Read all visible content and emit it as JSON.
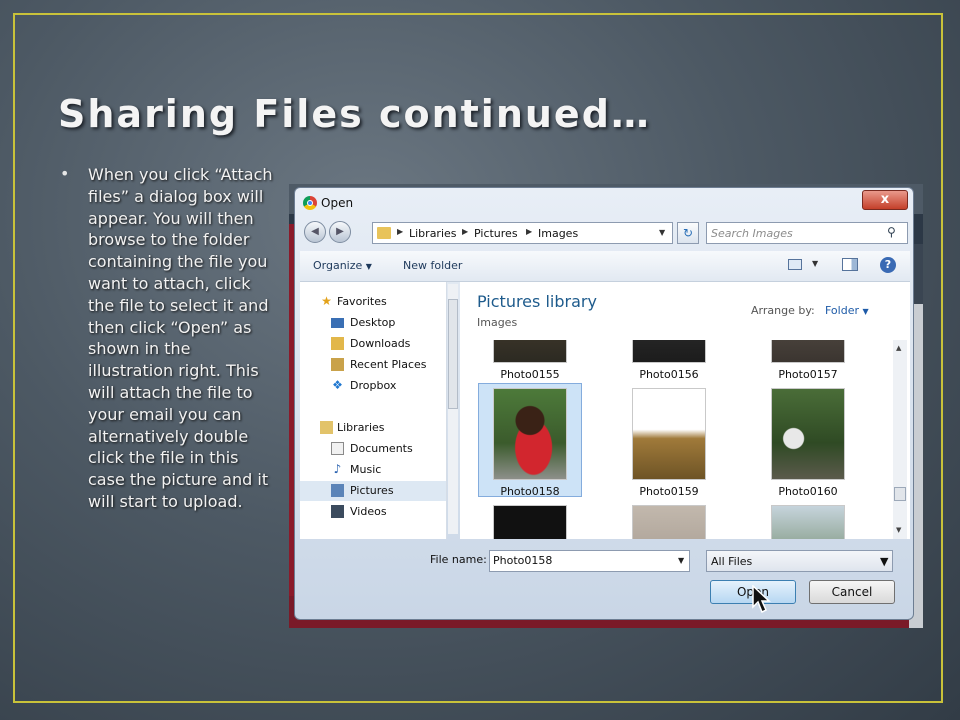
{
  "slide": {
    "title": "Sharing Files continued…",
    "bullet": "When you click “Attach files” a dialog box will appear. You will then browse to the folder containing the file you want to attach, click the file to select it and then click “Open” as shown in the illustration right. This will attach the file to your email you can alternatively double click the file in this case the picture and it will start  to upload."
  },
  "dialog": {
    "title": "Open",
    "close_glyph": "x",
    "breadcrumb": [
      "Libraries",
      "Pictures",
      "Images"
    ],
    "search_placeholder": "Search Images",
    "toolbar": {
      "organize": "Organize",
      "new_folder": "New folder"
    },
    "nav": {
      "favorites_label": "Favorites",
      "favorites": [
        "Desktop",
        "Downloads",
        "Recent Places",
        "Dropbox"
      ],
      "libraries_label": "Libraries",
      "libraries": [
        "Documents",
        "Music",
        "Pictures",
        "Videos"
      ],
      "selected": "Pictures"
    },
    "library": {
      "title": "Pictures library",
      "subtitle": "Images",
      "arrange_label": "Arrange by:",
      "arrange_value": "Folder"
    },
    "files": [
      {
        "name": "Photo0155"
      },
      {
        "name": "Photo0156"
      },
      {
        "name": "Photo0157"
      },
      {
        "name": "Photo0158",
        "selected": true
      },
      {
        "name": "Photo0159"
      },
      {
        "name": "Photo0160"
      }
    ],
    "file_name_label": "File name:",
    "file_name_value": "Photo0158",
    "file_type": "All Files",
    "open_label": "Open",
    "cancel_label": "Cancel"
  },
  "colors": {
    "frame": "#c9c23a",
    "library_title": "#1e5b8c",
    "selection": "#cde3f7"
  }
}
